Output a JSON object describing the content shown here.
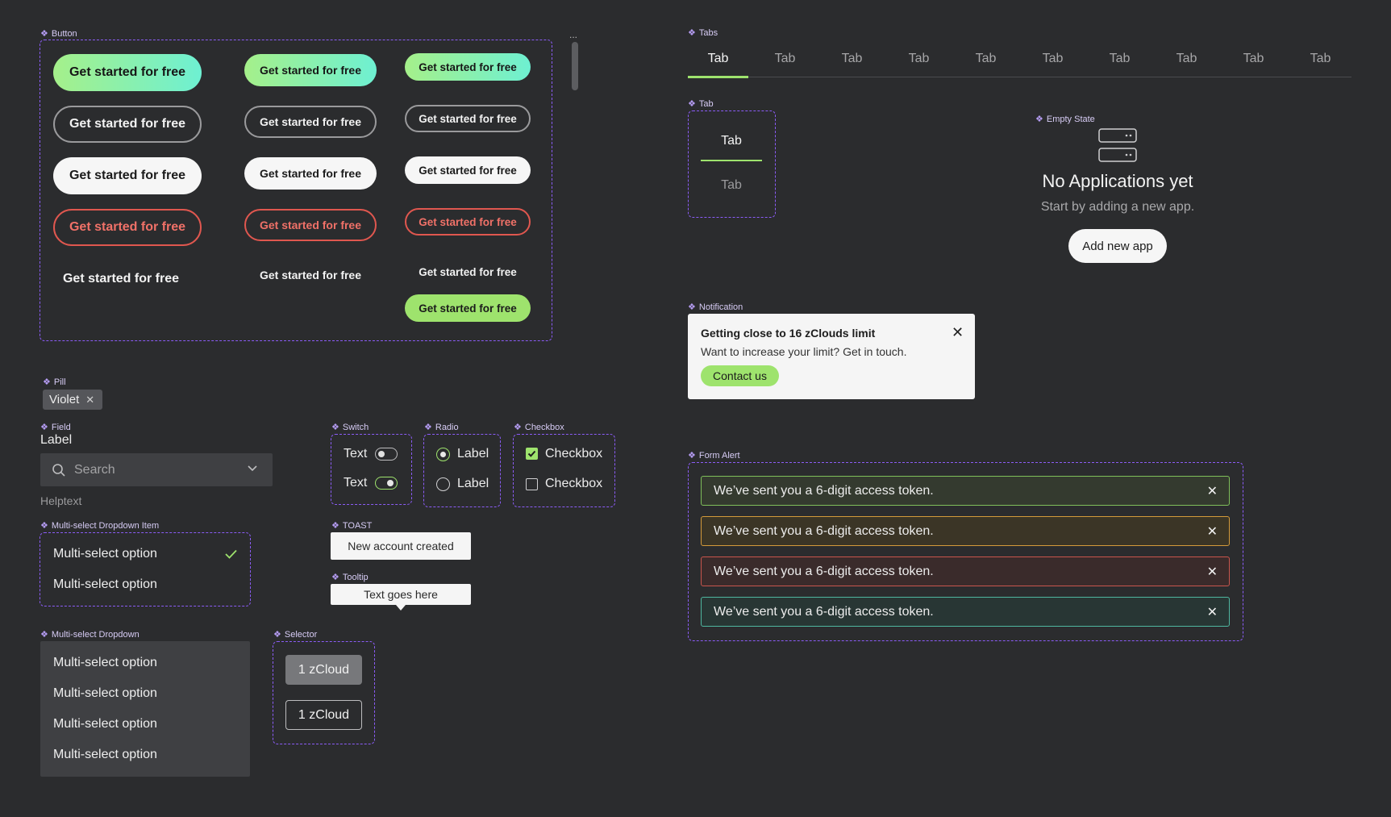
{
  "labels": {
    "button": "Button",
    "tabs": "Tabs",
    "tab": "Tab",
    "empty_state": "Empty State",
    "notification": "Notification",
    "form_alert": "Form Alert",
    "pill": "Pill",
    "field": "Field",
    "switch": "Switch",
    "radio": "Radio",
    "checkbox": "Checkbox",
    "multi_select_dropdown_item": "Multi-select Dropdown Item",
    "toast": "TOAST",
    "tooltip": "Tooltip",
    "multi_select_dropdown": "Multi-select Dropdown",
    "selector": "Selector"
  },
  "buttons": {
    "label": "Get started for free",
    "more": "..."
  },
  "tabs": {
    "items": [
      "Tab",
      "Tab",
      "Tab",
      "Tab",
      "Tab",
      "Tab",
      "Tab",
      "Tab",
      "Tab",
      "Tab"
    ],
    "active_index": 0
  },
  "tab_component": {
    "items": [
      "Tab",
      "Tab"
    ]
  },
  "empty_state": {
    "title": "No Applications yet",
    "subtitle": "Start by adding a new app.",
    "button": "Add new app",
    "icon": "server-stack-icon"
  },
  "notification": {
    "title": "Getting close to 16 zClouds limit",
    "body": "Want to increase your limit? Get in touch.",
    "button": "Contact us"
  },
  "form_alerts": [
    {
      "text": "We’ve sent you a 6-digit access token.",
      "variant": "success"
    },
    {
      "text": "We’ve sent you a 6-digit access token.",
      "variant": "warning"
    },
    {
      "text": "We’ve sent you a 6-digit access token.",
      "variant": "danger"
    },
    {
      "text": "We’ve sent you a 6-digit access token.",
      "variant": "info"
    }
  ],
  "pill": {
    "text": "Violet"
  },
  "field": {
    "label": "Label",
    "placeholder": "Search",
    "helptext": "Helptext"
  },
  "switch": {
    "items": [
      {
        "text": "Text",
        "on": false
      },
      {
        "text": "Text",
        "on": true
      }
    ]
  },
  "radio": {
    "items": [
      {
        "text": "Label",
        "checked": true
      },
      {
        "text": "Label",
        "checked": false
      }
    ]
  },
  "checkbox": {
    "items": [
      {
        "text": "Checkbox",
        "checked": true
      },
      {
        "text": "Checkbox",
        "checked": false
      }
    ]
  },
  "multi_select_item": {
    "items": [
      {
        "text": "Multi-select option",
        "selected": true
      },
      {
        "text": "Multi-select option",
        "selected": false
      }
    ]
  },
  "toast": {
    "text": "New account created"
  },
  "tooltip": {
    "text": "Text goes here"
  },
  "multi_select_dropdown": {
    "items": [
      "Multi-select option",
      "Multi-select option",
      "Multi-select option",
      "Multi-select option"
    ]
  },
  "selector": {
    "items": [
      {
        "text": "1 zCloud",
        "selected": true
      },
      {
        "text": "1 zCloud",
        "selected": false
      }
    ]
  },
  "colors": {
    "background": "#2b2c2e",
    "accent_violet": "#8b5cf6",
    "green": "#9ee36d",
    "danger": "#e0574f"
  }
}
